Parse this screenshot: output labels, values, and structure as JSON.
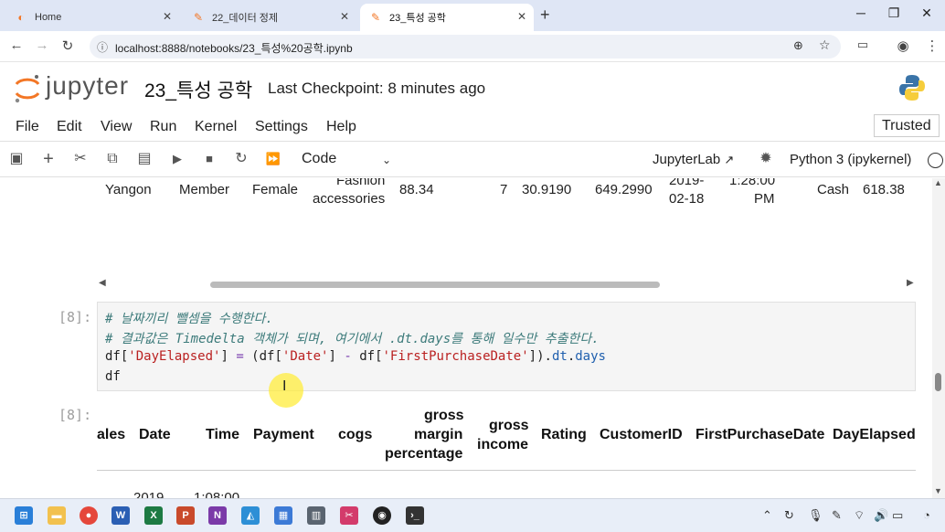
{
  "browser": {
    "tabs": [
      {
        "label": "Home",
        "active": false
      },
      {
        "label": "22_데이터 정제",
        "active": false
      },
      {
        "label": "23_특성 공학",
        "active": true
      }
    ],
    "new_tab": "+",
    "url": "localhost:8888/notebooks/23_특성%20공학.ipynb"
  },
  "jupyter": {
    "logo_text": "jupyter",
    "notebook_title": "23_특성 공학",
    "checkpoint": "Last Checkpoint: 8 minutes ago",
    "menu": [
      "File",
      "Edit",
      "View",
      "Run",
      "Kernel",
      "Settings",
      "Help"
    ],
    "trusted": "Trusted",
    "cell_type": "Code",
    "jupyterlab_link": "JupyterLab",
    "kernel": "Python 3 (ipykernel)"
  },
  "prev_output_row": {
    "city": "Yangon",
    "customer_type": "Member",
    "gender": "Female",
    "product_line_1": "Fashion",
    "product_line_2": "accessories",
    "unit_price": "88.34",
    "quantity": "7",
    "tax": "30.9190",
    "total": "649.2990",
    "date_1": "2019-",
    "date_2": "02-18",
    "time_1": "1:28:00",
    "time_2": "PM",
    "payment": "Cash",
    "cogs": "618.38"
  },
  "code_cell": {
    "prompt": "[8]:",
    "lines": {
      "comment1": "# 날짜끼리 뺄셈을 수행한다.",
      "comment2": "# 결과값은 Timedelta 객체가 되며, 여기에서 .dt.days를 통해 일수만 추출한다.",
      "line3_a": "df[",
      "line3_s1": "'DayElapsed'",
      "line3_b": "] ",
      "line3_eq": "=",
      "line3_c": " (df[",
      "line3_s2": "'Date'",
      "line3_d": "] ",
      "line3_minus": "-",
      "line3_e": " df[",
      "line3_s3": "'FirstPurchaseDate'",
      "line3_f": "]).",
      "line3_attr1": "dt",
      "line3_g": ".",
      "line3_attr2": "days",
      "line4": "df"
    }
  },
  "output_cell": {
    "prompt": "[8]:",
    "headers": {
      "sales": "ales",
      "date": "Date",
      "time": "Time",
      "payment": "Payment",
      "cogs": "cogs",
      "gmp_1": "gross",
      "gmp_2": "margin",
      "gmp_3": "percentage",
      "gi_1": "gross",
      "gi_2": "income",
      "rating": "Rating",
      "customer_id": "CustomerID",
      "first_purchase": "FirstPurchaseDate",
      "day_elapsed": "DayElapsed"
    },
    "partial_row": {
      "date": "2019",
      "time": "1:08:00"
    }
  },
  "colors": {
    "tabbar_bg": "#dfe6f5",
    "jupyter_orange": "#f37726",
    "code_bg": "#f5f5f5"
  }
}
